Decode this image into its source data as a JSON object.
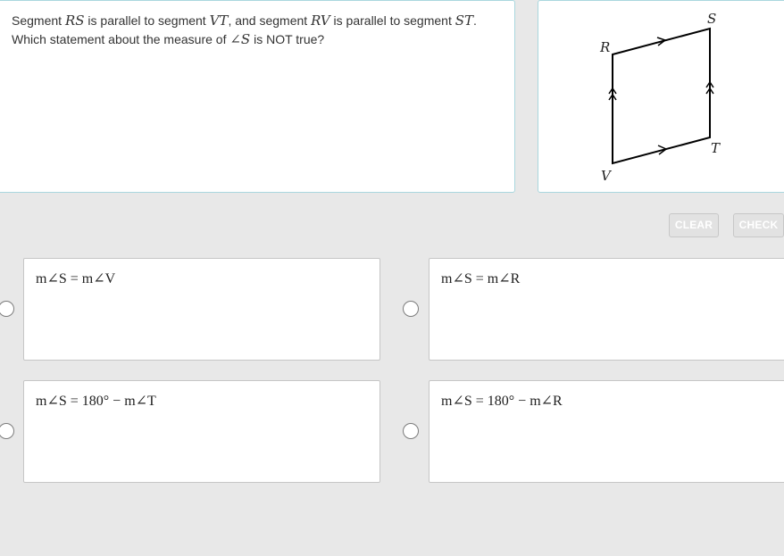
{
  "question": {
    "line1": {
      "t1": "Segment ",
      "m1": "RS",
      "t2": " is parallel to segment ",
      "m2": "VT",
      "t3": ", and segment ",
      "m3": "RV",
      "t4": " is parallel to segment ",
      "m4": "ST",
      "t5": "."
    },
    "line2": {
      "t1": "Which statement about the measure of ",
      "m1": "∠S",
      "t2": " is NOT true?"
    }
  },
  "figure": {
    "labels": {
      "R": "R",
      "S": "S",
      "T": "T",
      "V": "V"
    }
  },
  "buttons": {
    "clear": "CLEAR",
    "check": "CHECK"
  },
  "choices": [
    {
      "text": "m∠S = m∠V",
      "selected": false
    },
    {
      "text": "m∠S = m∠R",
      "selected": false
    },
    {
      "text": "m∠S = 180° − m∠T",
      "selected": false
    },
    {
      "text": "m∠S = 180° − m∠R",
      "selected": false
    }
  ]
}
